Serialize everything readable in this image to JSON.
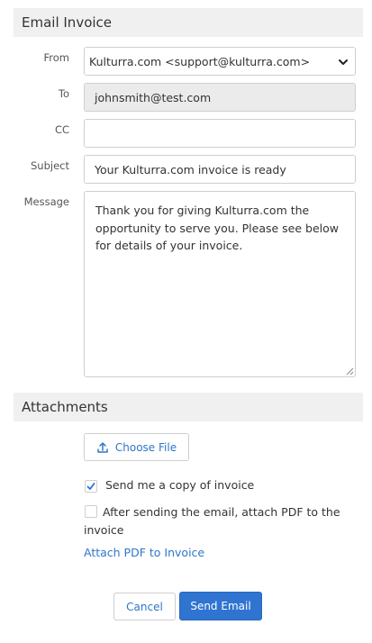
{
  "email_section": {
    "title": "Email Invoice",
    "from_label": "From",
    "from_value": "Kulturra.com <support@kulturra.com>",
    "to_label": "To",
    "to_value": "johnsmith@test.com",
    "cc_label": "CC",
    "cc_value": "",
    "subject_label": "Subject",
    "subject_value": "Your Kulturra.com invoice is ready",
    "message_label": "Message",
    "message_value": "Thank you for giving Kulturra.com the opportunity to serve you. Please see below for details of your invoice."
  },
  "attachments_section": {
    "title": "Attachments",
    "choose_file_label": "Choose File",
    "send_copy_label": "Send me a copy of invoice",
    "send_copy_checked": true,
    "attach_pdf_after_label": "After sending the email, attach PDF to the invoice",
    "attach_pdf_after_checked": false,
    "attach_pdf_link": "Attach PDF to Invoice"
  },
  "actions": {
    "cancel_label": "Cancel",
    "send_label": "Send Email"
  },
  "colors": {
    "accent": "#2f74d0",
    "link": "#2f76c8",
    "header_bg": "#f0f0f0"
  }
}
